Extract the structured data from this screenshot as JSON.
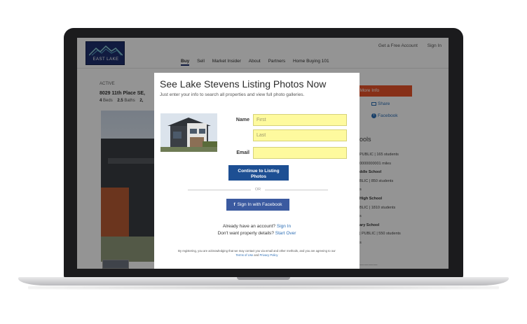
{
  "brand": {
    "logo_text": "EAST LAKE",
    "accent": "#1e2f6e"
  },
  "header": {
    "top_links": [
      "Get a Free Account",
      "Sign In"
    ],
    "nav": [
      "Buy",
      "Sell",
      "Market Insider",
      "About",
      "Partners",
      "Home Buying 101"
    ],
    "active_nav": "Buy"
  },
  "listing": {
    "status": "ACTIVE",
    "address": "8029 11th Place SE,",
    "beds": "4",
    "beds_label": "Beds",
    "baths": "2.5",
    "baths_label": "Baths",
    "extra": "2,"
  },
  "sidebar": {
    "more_info": "t More Info",
    "share": "Share",
    "facebook": "Facebook",
    "schools_title": "ools",
    "schools": [
      {
        "line": "PUBLIC | 165 students",
        "bold": false
      },
      {
        "line": "0000000001 miles",
        "bold": false
      },
      {
        "line": "ddle School",
        "bold": true
      },
      {
        "line": "BLIC | 850 students",
        "bold": false
      },
      {
        "line": "s",
        "bold": false
      },
      {
        "line": "High School",
        "bold": true
      },
      {
        "line": "BLIC | 1810 students",
        "bold": false
      },
      {
        "line": "s",
        "bold": false
      },
      {
        "line": "ary School",
        "bold": true
      },
      {
        "line": "| PUBLIC | 550 students",
        "bold": false
      },
      {
        "line": "s",
        "bold": false
      }
    ]
  },
  "modal": {
    "title": "See Lake Stevens Listing Photos Now",
    "subtitle": "Just enter your info to search all properties and view full photo galleries.",
    "name_label": "Name",
    "first_placeholder": "First",
    "last_placeholder": "Last",
    "email_label": "Email",
    "continue_line1": "Continue to Listing",
    "continue_line2": "Photos",
    "or": "OR",
    "facebook_button": "Sign In with Facebook",
    "already_text": "Already have an account?",
    "sign_in_link": "Sign In",
    "no_details_text": "Don't want property details?",
    "start_over_link": "Start Over",
    "legal_line1": "By registering, you are acknowledging that we may contact you via email and other methods, and you are agreeing to our",
    "terms_link": "Terms of Use",
    "legal_and": "and",
    "privacy_link": "Privacy Policy"
  },
  "colors": {
    "cta_orange": "#e8542a",
    "button_blue": "#1d4f93",
    "facebook_blue": "#3b5aa0",
    "input_yellow": "#fefa9e",
    "link_blue": "#2c6eb5"
  }
}
